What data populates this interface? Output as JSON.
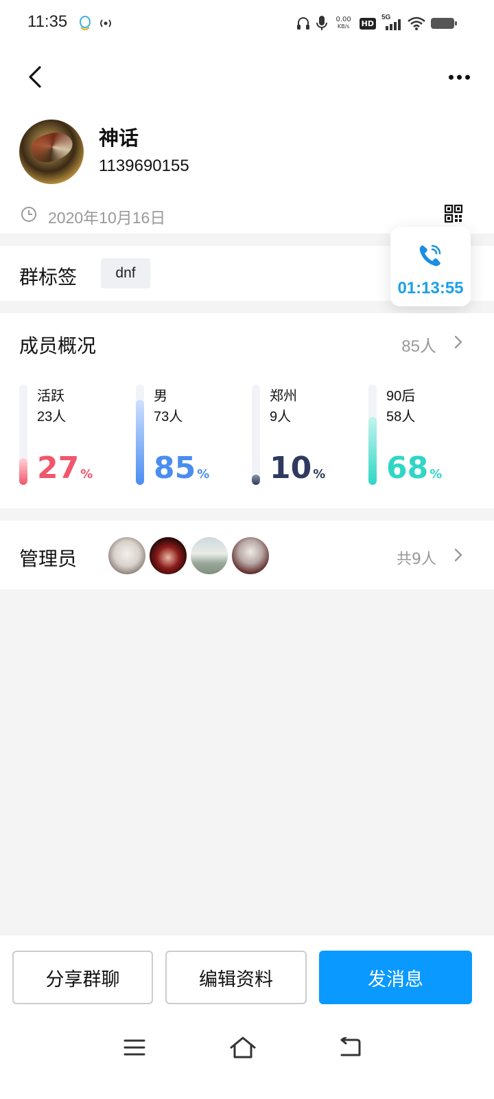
{
  "status_bar": {
    "time": "11:35",
    "net_speed_value": "0.00",
    "net_speed_unit": "KB/s",
    "hd_label": "HD",
    "network_label": "5G"
  },
  "header": {
    "group_name": "神话",
    "group_id": "1139690155",
    "created_date": "2020年10月16日"
  },
  "tags": {
    "label": "群标签",
    "items": [
      "dnf"
    ]
  },
  "call": {
    "duration": "01:13:55",
    "color": "#1aa0e8"
  },
  "members": {
    "title": "成员概况",
    "total": "85人",
    "stats": [
      {
        "name": "活跃",
        "count": "23人",
        "percent": "27",
        "percent_sign": "%",
        "fraction": 0.27,
        "color": "#f0576b",
        "fill_top": "#ffd3d8"
      },
      {
        "name": "男",
        "count": "73人",
        "percent": "85",
        "percent_sign": "%",
        "fraction": 0.85,
        "color": "#4a8df0",
        "fill_top": "#cfe0ff"
      },
      {
        "name": "郑州",
        "count": "9人",
        "percent": "10",
        "percent_sign": "%",
        "fraction": 0.1,
        "color": "#2f3b5e",
        "fill_top": "#8b92a8"
      },
      {
        "name": "90后",
        "count": "58人",
        "percent": "68",
        "percent_sign": "%",
        "fraction": 0.68,
        "color": "#2fd6c6",
        "fill_top": "#c4f4ee"
      }
    ]
  },
  "admins": {
    "label": "管理员",
    "count": "共9人"
  },
  "actions": {
    "share": "分享群聊",
    "edit": "编辑资料",
    "message": "发消息"
  }
}
